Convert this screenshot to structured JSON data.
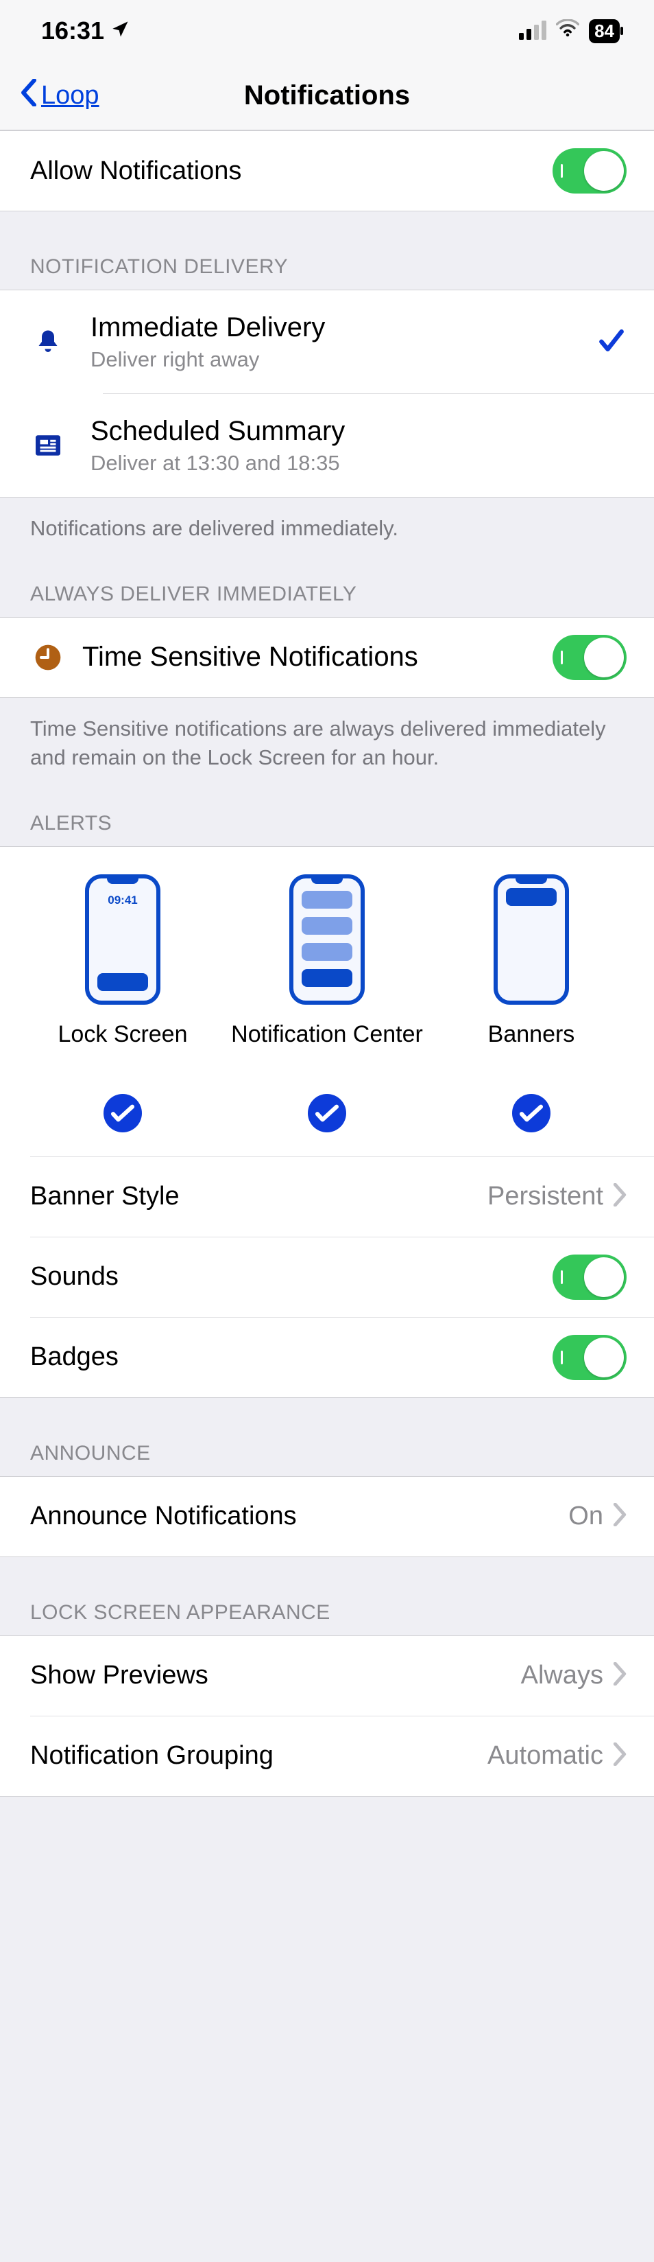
{
  "status": {
    "time": "16:31",
    "battery": "84"
  },
  "nav": {
    "back": "Loop",
    "title": "Notifications"
  },
  "allow": {
    "label": "Allow Notifications"
  },
  "delivery": {
    "header": "NOTIFICATION DELIVERY",
    "immediate": {
      "title": "Immediate Delivery",
      "sub": "Deliver right away"
    },
    "scheduled": {
      "title": "Scheduled Summary",
      "sub": "Deliver at 13:30 and 18:35"
    },
    "footer": "Notifications are delivered immediately."
  },
  "always": {
    "header": "ALWAYS DELIVER IMMEDIATELY",
    "timeSensitive": "Time Sensitive Notifications",
    "footer": "Time Sensitive notifications are always delivered immediately and remain on the Lock Screen for an hour."
  },
  "alerts": {
    "header": "ALERTS",
    "lock": "Lock Screen",
    "center": "Notification Center",
    "banners": "Banners",
    "lockTime": "09:41",
    "bannerStyle": {
      "label": "Banner Style",
      "value": "Persistent"
    },
    "sounds": "Sounds",
    "badges": "Badges"
  },
  "announce": {
    "header": "ANNOUNCE",
    "label": "Announce Notifications",
    "value": "On"
  },
  "lockScreenAppearance": {
    "header": "LOCK SCREEN APPEARANCE",
    "previews": {
      "label": "Show Previews",
      "value": "Always"
    },
    "grouping": {
      "label": "Notification Grouping",
      "value": "Automatic"
    }
  }
}
